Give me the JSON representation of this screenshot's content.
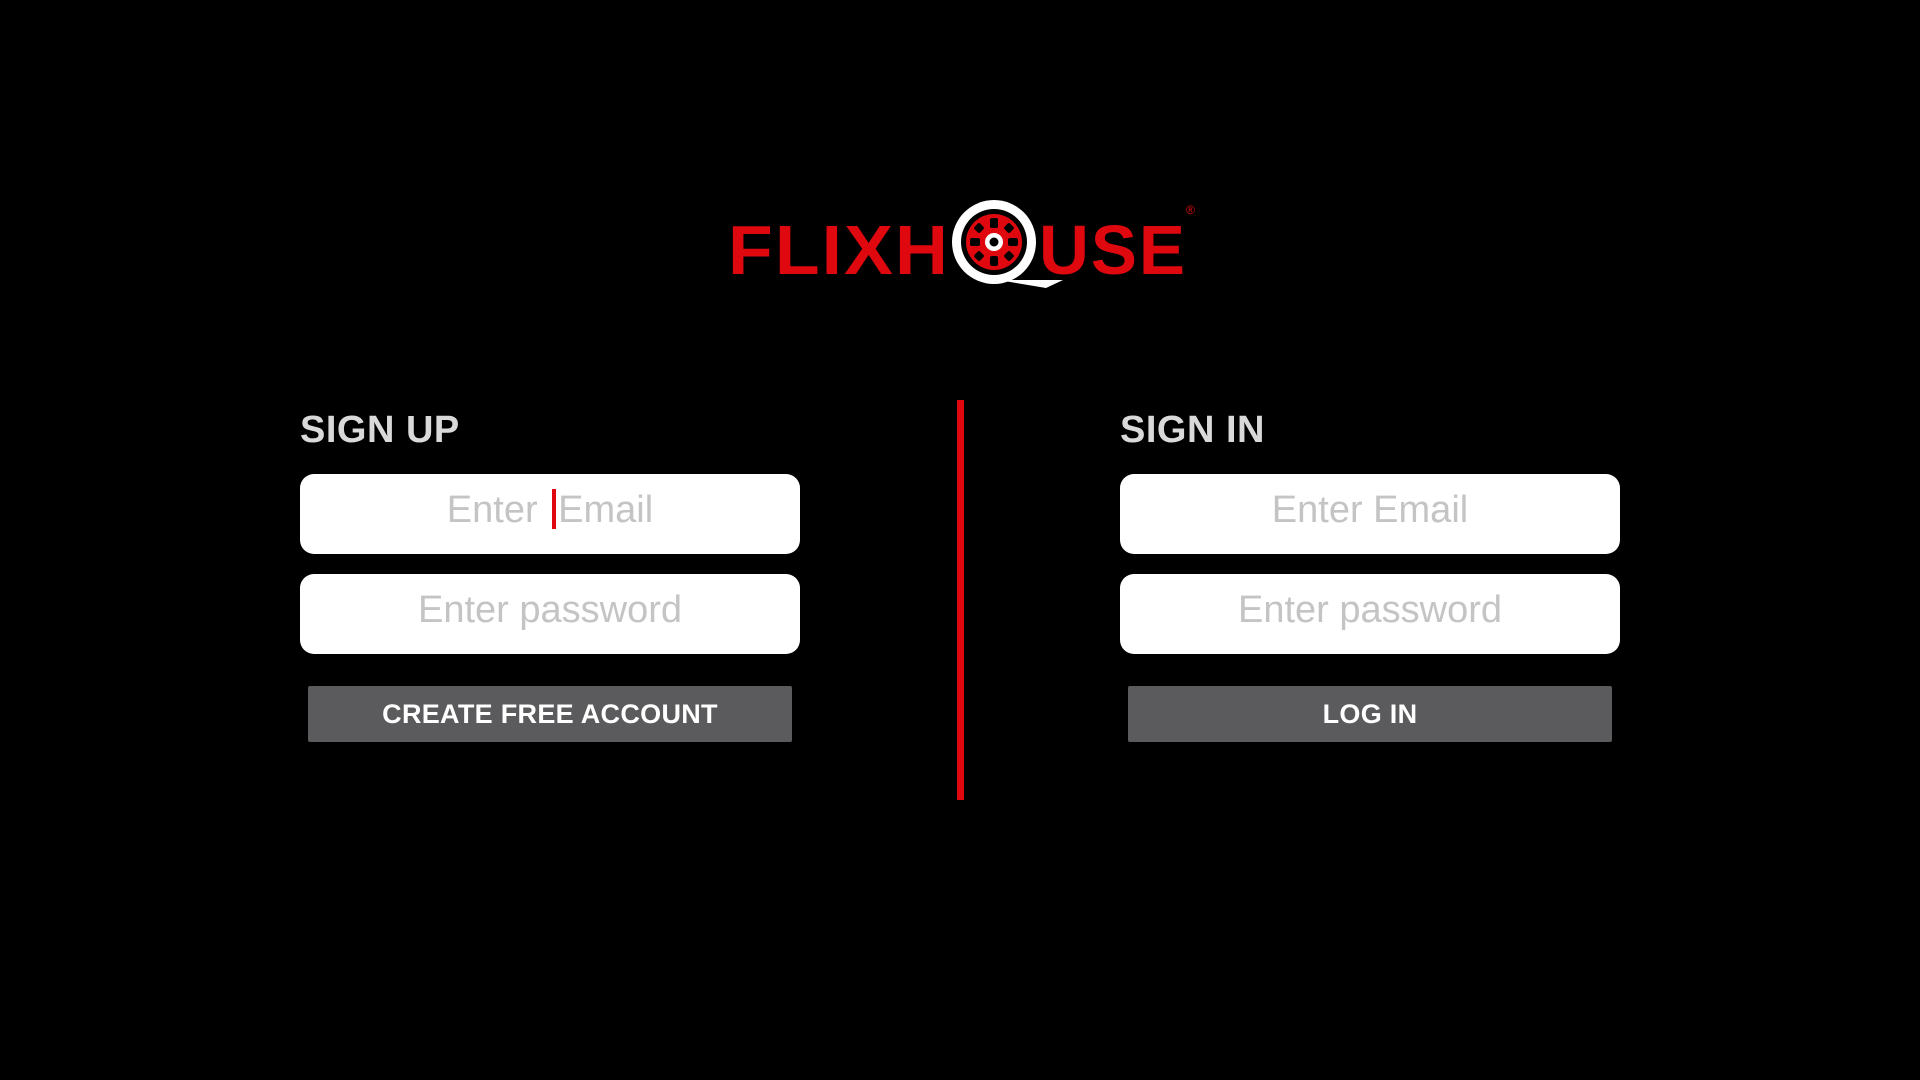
{
  "brand": {
    "logo_text_left": "FLIXH",
    "logo_text_right": "USE",
    "registered_mark": "®",
    "accent_color": "#e0080f"
  },
  "signup": {
    "title": "SIGN UP",
    "email": {
      "placeholder_before_cursor": "Enter ",
      "placeholder_after_cursor": "Email",
      "value": ""
    },
    "password": {
      "placeholder": "Enter password",
      "value": ""
    },
    "button_label": "CREATE FREE ACCOUNT"
  },
  "signin": {
    "title": "SIGN IN",
    "email": {
      "placeholder": "Enter Email",
      "value": ""
    },
    "password": {
      "placeholder": "Enter password",
      "value": ""
    },
    "button_label": "LOG IN"
  }
}
